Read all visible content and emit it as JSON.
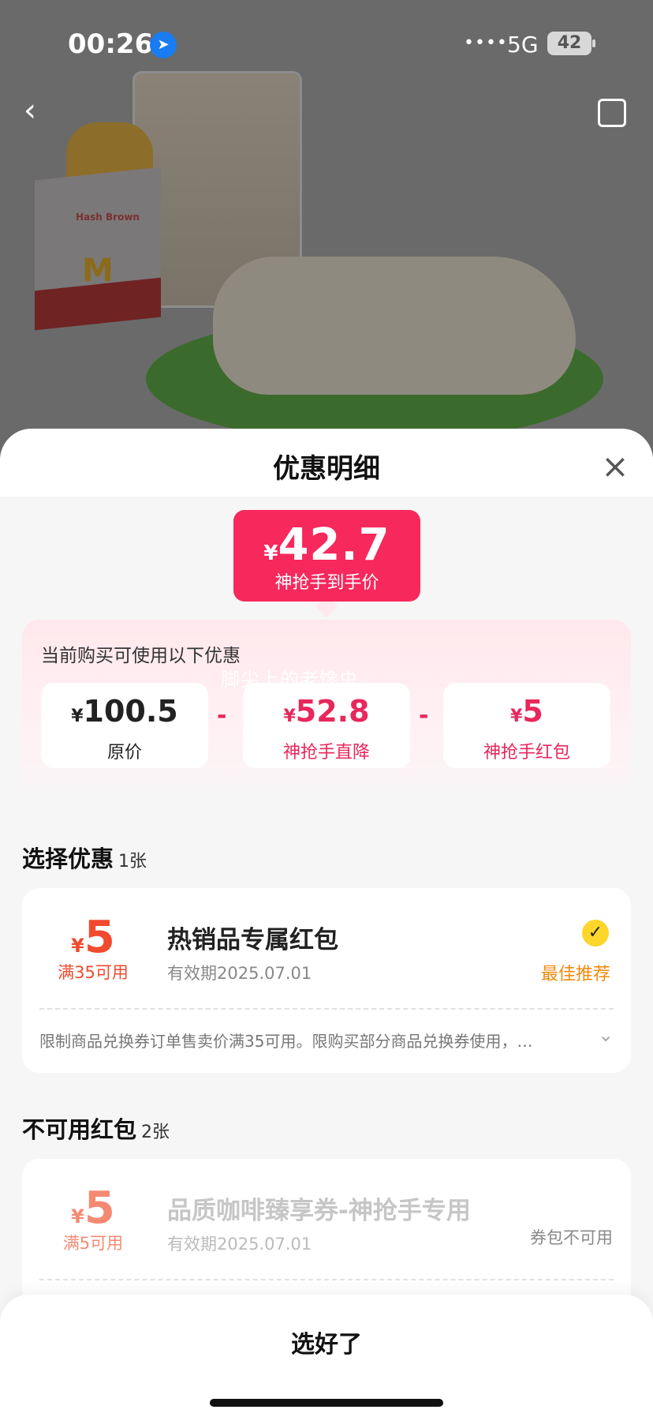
{
  "status_bar": {
    "time": "00:26",
    "signal": "••••",
    "network": "5G",
    "battery": "42"
  },
  "sheet": {
    "title": "优惠明细",
    "final_price": {
      "currency": "¥",
      "amount": "42.7",
      "label": "神抢手到手价"
    },
    "breakdown": {
      "title": "当前购买可使用以下优惠",
      "watermark": "脚尖上的老馋虫",
      "items": [
        {
          "currency": "¥",
          "amount": "100.5",
          "label": "原价"
        },
        {
          "currency": "¥",
          "amount": "52.8",
          "label": "神抢手直降"
        },
        {
          "currency": "¥",
          "amount": "5",
          "label": "神抢手红包"
        }
      ],
      "operator": "-"
    },
    "choose_section": {
      "title": "选择优惠",
      "count": "1张"
    },
    "coupon_available": {
      "currency": "¥",
      "amount": "5",
      "condition": "满35可用",
      "name": "热销品专属红包",
      "validity": "有效期2025.07.01",
      "tag": "最佳推荐",
      "description": "限制商品兑换券订单售卖价满35可用。限购买部分商品兑换券使用，…"
    },
    "unavailable_section": {
      "title": "不可用红包",
      "count": "2张"
    },
    "coupon_unavailable": {
      "currency": "¥",
      "amount": "5",
      "condition": "满5可用",
      "name": "品质咖啡臻享券-神抢手专用",
      "validity": "有效期2025.07.01",
      "status": "券包不可用"
    },
    "confirm_label": "选好了"
  },
  "hero": {
    "bag_text": "Hash Brown",
    "logo": "M"
  },
  "colors": {
    "accent": "#f7285c",
    "coupon_red": "#f04a2f",
    "best_orange": "#f08a0e",
    "check_yellow": "#fcd62a"
  },
  "icons": {
    "back": "chevron-left-icon",
    "share": "share-icon",
    "close": "close-icon",
    "location": "location-arrow-icon",
    "expand": "chevron-down-icon",
    "check": "check-icon"
  }
}
